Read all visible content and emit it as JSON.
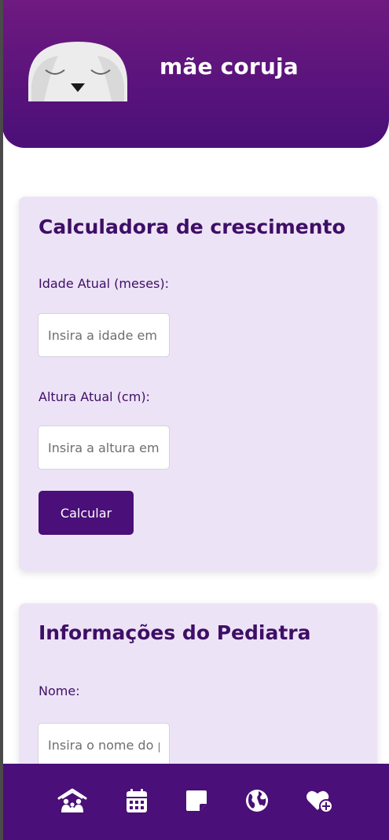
{
  "header": {
    "brand": "mãe coruja",
    "logo_icon": "sleeping-owl-icon"
  },
  "growth_calculator": {
    "title": "Calculadora de crescimento",
    "age_label": "Idade Atual (meses):",
    "age_placeholder": "Insira a idade em meses",
    "age_value": "",
    "height_label": "Altura Atual (cm):",
    "height_placeholder": "Insira a altura em cm",
    "height_value": "",
    "calculate_label": "Calcular"
  },
  "pediatrician": {
    "title": "Informações do Pediatra",
    "name_label": "Nome:",
    "name_placeholder": "Insira o nome do pediatra",
    "name_value": ""
  },
  "bottom_nav": {
    "items": [
      {
        "icon": "family-home-icon"
      },
      {
        "icon": "calendar-icon"
      },
      {
        "icon": "sticky-note-icon"
      },
      {
        "icon": "globe-icon"
      },
      {
        "icon": "heart-plus-icon"
      }
    ]
  },
  "colors": {
    "primary": "#4a0f78",
    "header_gradient_top": "#6f1a80",
    "card_background": "#ede3f6",
    "text_primary": "#3e0f66"
  }
}
